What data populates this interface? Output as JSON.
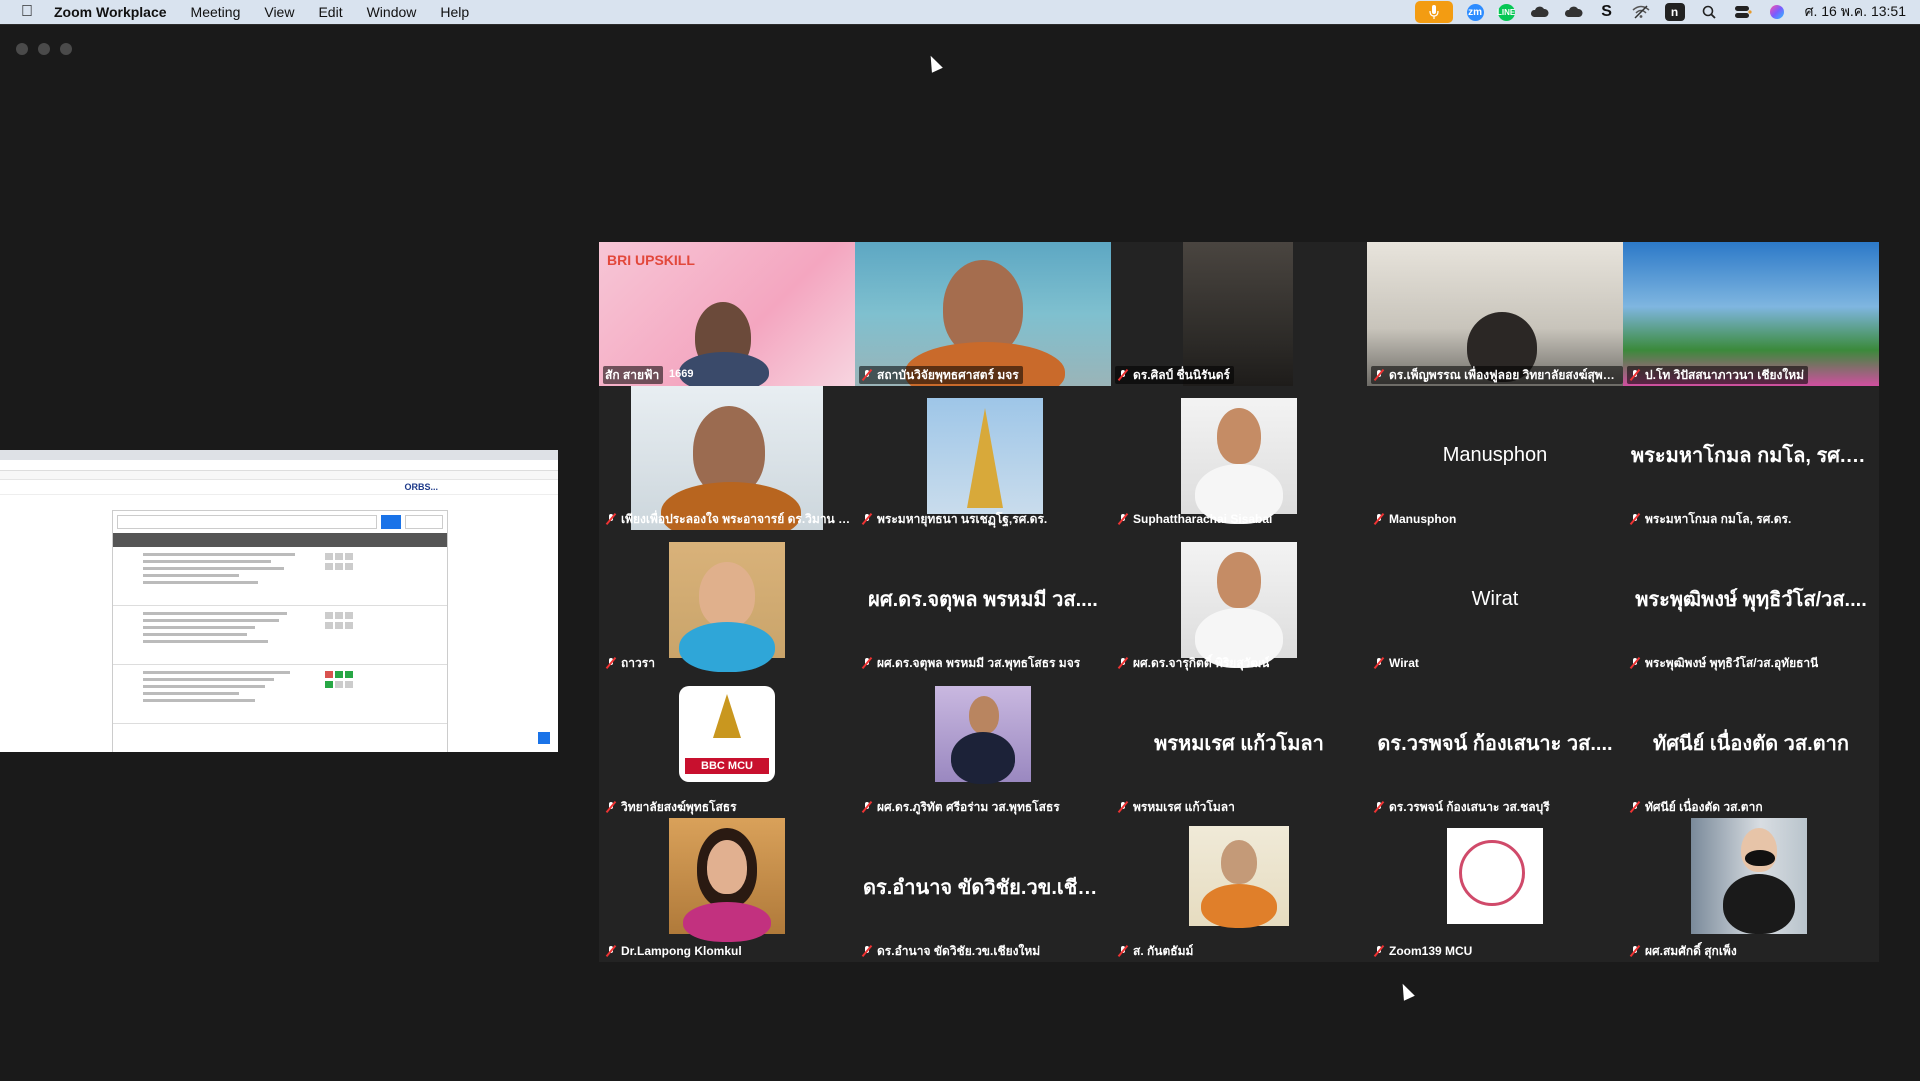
{
  "menubar": {
    "app_name": "Zoom Workplace",
    "menus": [
      "Meeting",
      "View",
      "Edit",
      "Window",
      "Help"
    ],
    "clock": "ศ. 16 พ.ค.  13:51",
    "icons": [
      "microphone-icon",
      "zoom-icon",
      "line-icon",
      "cloud-icon",
      "cloud-icon",
      "s-icon",
      "wifi-off-icon",
      "n-icon",
      "search-icon",
      "control-center-icon",
      "siri-icon"
    ],
    "n_label": "n"
  },
  "shared_screen": {
    "brand": "ORBS..."
  },
  "participants": [
    {
      "name": "สัก สายฟ้า",
      "overlay": "1669",
      "kind": "video-pink-banner",
      "banner": "BRI UPSKILL"
    },
    {
      "name": "สถาบันวิจัยพุทธศาสตร์ มจร",
      "kind": "video-monk",
      "active": true
    },
    {
      "name": "ดร.ศิลป์ ชื่นนิรันดร์",
      "kind": "video-dark"
    },
    {
      "name": "ดร.เพ็ญพรรณ เพื่องฟูลอย วิทยาลัยสงฆ์สุพร...",
      "kind": "video-landscape"
    },
    {
      "name": "ป.โท วิปัสสนาภาวนา เชียงใหม่",
      "kind": "video-banner-blue"
    },
    {
      "name": "เพียงเพื่อประลองใจ พระอาจารย์ ดร.วิมาน คั...",
      "kind": "video-monk-wide"
    },
    {
      "name": "พระมหายุทธนา นรเชฏฺโฐ,รศ.ดร.",
      "kind": "photo-stupa"
    },
    {
      "name": "Suphattharachai Sisabai",
      "kind": "photo-uniform"
    },
    {
      "name": "Manusphon",
      "big": "Manusphon",
      "kind": "name"
    },
    {
      "name": "พระมหาโกมล กมโล, รศ.ดร.",
      "big": "พระมหาโกมล กมโล, รศ.ดร.",
      "kind": "name"
    },
    {
      "name": "ถาวรา",
      "kind": "photo-glasses"
    },
    {
      "name": "ผศ.ดร.จตุพล  พรหมมี วส.พุทธโสธร มจร",
      "big": "ผศ.ดร.จตุพล  พรหมมี วส....",
      "kind": "name"
    },
    {
      "name": "ผศ.ดร.จารุกิตติ์ พิริยสุวัฒน์",
      "kind": "photo-uniform"
    },
    {
      "name": "Wirat",
      "big": "Wirat",
      "kind": "name"
    },
    {
      "name": "พระพุฒิพงษ์ พุทฺธิวํโส/วส.อุทัยธานี",
      "big": "พระพุฒิพงษ์ พุทฺธิวํโส/วส....",
      "kind": "name"
    },
    {
      "name": "วิทยาลัยสงฆ์พุทธโสธร",
      "kind": "photo-logo",
      "logo_text": "BBC MCU"
    },
    {
      "name": "ผศ.ดร.ภูริทัต ศรีอร่าม วส.พุทธโสธร",
      "kind": "photo-suit"
    },
    {
      "name": "พรหมเรศ แก้วโมลา",
      "big": "พรหมเรศ แก้วโมลา",
      "kind": "name"
    },
    {
      "name": "ดร.วรพจน์ ก้องเสนาะ วส.ชลบุรี",
      "big": "ดร.วรพจน์ ก้องเสนาะ วส....",
      "kind": "name"
    },
    {
      "name": "ทัศนีย์ เนื่องตัด วส.ตาก",
      "big": "ทัศนีย์ เนื่องตัด วส.ตาก",
      "kind": "name"
    },
    {
      "name": "Dr.Lampong Klomkul",
      "kind": "photo-woman"
    },
    {
      "name": "ดร.อำนาจ ขัดวิชัย.วข.เชียงใหม่",
      "big": "ดร.อำนาจ ขัดวิชัย.วข.เชีย...",
      "kind": "name"
    },
    {
      "name": "ส. กันตธัมม์",
      "kind": "photo-monk"
    },
    {
      "name": "Zoom139 MCU",
      "kind": "photo-seal"
    },
    {
      "name": "ผศ.สมศักดิ์ สุกเพ็ง",
      "kind": "photo-mask"
    }
  ]
}
